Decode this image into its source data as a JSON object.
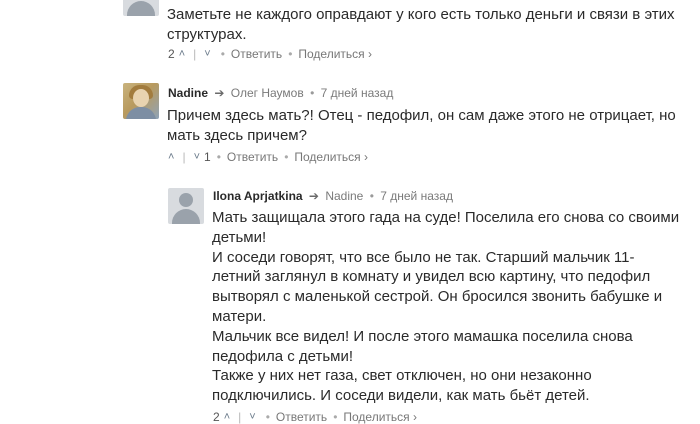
{
  "comments": [
    {
      "author": "",
      "reply_to": "",
      "time": "",
      "lines": [
        "Заметьте не каждого оправдают у кого есть только деньги и связи в этих",
        "структурах."
      ],
      "upvotes": "2",
      "downvotes": "",
      "reply_label": "Ответить",
      "share_label": "Поделиться ›"
    },
    {
      "author": "Nadine",
      "reply_to": "Олег Наумов",
      "time": "7 дней назад",
      "lines": [
        "Причем здесь мать?! Отец - педофил, он сам даже этого не отрицает, но",
        "мать здесь причем?"
      ],
      "upvotes": "",
      "downvotes": "1",
      "reply_label": "Ответить",
      "share_label": "Поделиться ›"
    },
    {
      "author": "Ilona Aprjatkina",
      "reply_to": "Nadine",
      "time": "7 дней назад",
      "lines": [
        "Мать защищала этого гада на суде! Поселила его снова со своими",
        "детьми!",
        "И соседи говорят, что все было не так. Старший мальчик 11-",
        "летний заглянул в комнату и увидел всю картину, что педофил",
        "вытворял с маленькой сестрой. Он бросился звонить бабушке и",
        "матери.",
        "Мальчик все видел! И после этого мамашка поселила снова",
        "педофила с детьми!",
        "Также у них нет газа, свет отключен, но они незаконно",
        "подключились. И соседи видели, как мать бьёт детей."
      ],
      "upvotes": "2",
      "downvotes": "",
      "reply_label": "Ответить",
      "share_label": "Поделиться ›"
    }
  ],
  "icons": {
    "reply_arrow": "reply-arrow-icon",
    "upvote": "chevron-up-icon",
    "downvote": "chevron-down-icon"
  },
  "colors": {
    "text": "#2a2a2a",
    "meta": "#7a7a7a",
    "action": "#777777"
  }
}
